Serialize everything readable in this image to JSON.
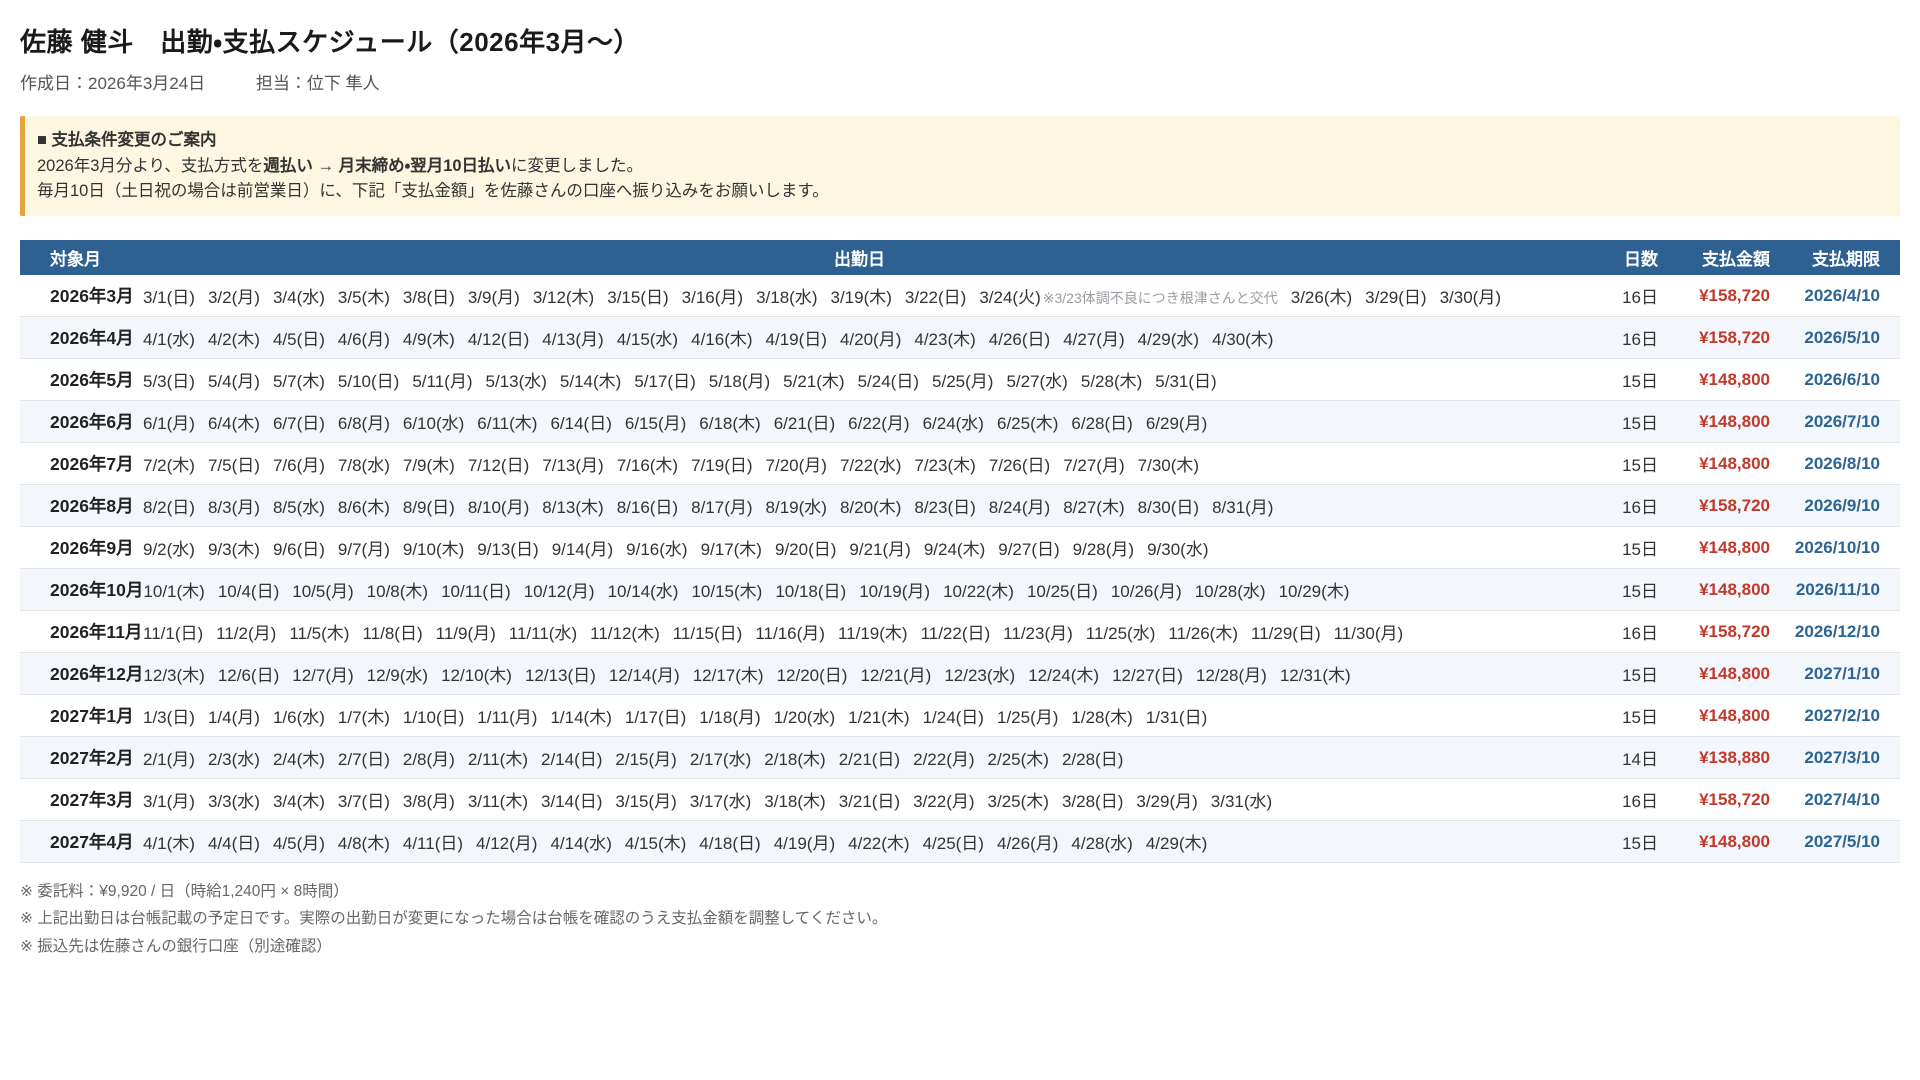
{
  "page": {
    "title": "佐藤 健斗　出勤・支払スケジュール（2026年3月〜）",
    "created_label": "作成日：2026年3月24日",
    "staff_label": "担当：位下 隼人"
  },
  "notice": {
    "heading": "■ 支払条件変更のご案内",
    "line1_pre": "2026年3月分より、支払方式を",
    "line1_bold1": "週払い",
    "line1_mid": " → ",
    "line1_bold2": "月末締め・翌月10日払い",
    "line1_post": "に変更しました。",
    "line2": "毎月10日（土日祝の場合は前営業日）に、下記「支払金額」を佐藤さんの口座へ振り込みをお願いします。"
  },
  "colors": {
    "table_header_bg": "#2e6191",
    "stripe_bg": "#f3f6fa",
    "amount_red": "#c0392b",
    "deadline_blue": "#2c6496",
    "notice_bg": "#fdf7e2",
    "notice_border": "#e8a33d"
  },
  "table": {
    "headers": {
      "month": "対象月",
      "dates": "出勤日",
      "days": "日数",
      "amount": "支払金額",
      "deadline": "支払期限"
    },
    "rows": [
      {
        "month": "2026年3月",
        "dates": [
          "3/1(日)",
          "3/2(月)",
          "3/4(水)",
          "3/5(木)",
          "3/8(日)",
          "3/9(月)",
          "3/12(木)",
          "3/15(日)",
          "3/16(月)",
          "3/18(水)",
          "3/19(木)",
          "3/22(日)",
          "3/24(火)",
          "3/26(木)",
          "3/29(日)",
          "3/30(月)"
        ],
        "inline_note": {
          "after_index": 12,
          "text": "※3/23体調不良につき根津さんと交代"
        },
        "days": "16日",
        "amount": "¥158,720",
        "deadline": "2026/4/10"
      },
      {
        "month": "2026年4月",
        "dates": [
          "4/1(水)",
          "4/2(木)",
          "4/5(日)",
          "4/6(月)",
          "4/9(木)",
          "4/12(日)",
          "4/13(月)",
          "4/15(水)",
          "4/16(木)",
          "4/19(日)",
          "4/20(月)",
          "4/23(木)",
          "4/26(日)",
          "4/27(月)",
          "4/29(水)",
          "4/30(木)"
        ],
        "days": "16日",
        "amount": "¥158,720",
        "deadline": "2026/5/10"
      },
      {
        "month": "2026年5月",
        "dates": [
          "5/3(日)",
          "5/4(月)",
          "5/7(木)",
          "5/10(日)",
          "5/11(月)",
          "5/13(水)",
          "5/14(木)",
          "5/17(日)",
          "5/18(月)",
          "5/21(木)",
          "5/24(日)",
          "5/25(月)",
          "5/27(水)",
          "5/28(木)",
          "5/31(日)"
        ],
        "days": "15日",
        "amount": "¥148,800",
        "deadline": "2026/6/10"
      },
      {
        "month": "2026年6月",
        "dates": [
          "6/1(月)",
          "6/4(木)",
          "6/7(日)",
          "6/8(月)",
          "6/10(水)",
          "6/11(木)",
          "6/14(日)",
          "6/15(月)",
          "6/18(木)",
          "6/21(日)",
          "6/22(月)",
          "6/24(水)",
          "6/25(木)",
          "6/28(日)",
          "6/29(月)"
        ],
        "days": "15日",
        "amount": "¥148,800",
        "deadline": "2026/7/10"
      },
      {
        "month": "2026年7月",
        "dates": [
          "7/2(木)",
          "7/5(日)",
          "7/6(月)",
          "7/8(水)",
          "7/9(木)",
          "7/12(日)",
          "7/13(月)",
          "7/16(木)",
          "7/19(日)",
          "7/20(月)",
          "7/22(水)",
          "7/23(木)",
          "7/26(日)",
          "7/27(月)",
          "7/30(木)"
        ],
        "days": "15日",
        "amount": "¥148,800",
        "deadline": "2026/8/10"
      },
      {
        "month": "2026年8月",
        "dates": [
          "8/2(日)",
          "8/3(月)",
          "8/5(水)",
          "8/6(木)",
          "8/9(日)",
          "8/10(月)",
          "8/13(木)",
          "8/16(日)",
          "8/17(月)",
          "8/19(水)",
          "8/20(木)",
          "8/23(日)",
          "8/24(月)",
          "8/27(木)",
          "8/30(日)",
          "8/31(月)"
        ],
        "days": "16日",
        "amount": "¥158,720",
        "deadline": "2026/9/10"
      },
      {
        "month": "2026年9月",
        "dates": [
          "9/2(水)",
          "9/3(木)",
          "9/6(日)",
          "9/7(月)",
          "9/10(木)",
          "9/13(日)",
          "9/14(月)",
          "9/16(水)",
          "9/17(木)",
          "9/20(日)",
          "9/21(月)",
          "9/24(木)",
          "9/27(日)",
          "9/28(月)",
          "9/30(水)"
        ],
        "days": "15日",
        "amount": "¥148,800",
        "deadline": "2026/10/10"
      },
      {
        "month": "2026年10月",
        "dates": [
          "10/1(木)",
          "10/4(日)",
          "10/5(月)",
          "10/8(木)",
          "10/11(日)",
          "10/12(月)",
          "10/14(水)",
          "10/15(木)",
          "10/18(日)",
          "10/19(月)",
          "10/22(木)",
          "10/25(日)",
          "10/26(月)",
          "10/28(水)",
          "10/29(木)"
        ],
        "days": "15日",
        "amount": "¥148,800",
        "deadline": "2026/11/10"
      },
      {
        "month": "2026年11月",
        "dates": [
          "11/1(日)",
          "11/2(月)",
          "11/5(木)",
          "11/8(日)",
          "11/9(月)",
          "11/11(水)",
          "11/12(木)",
          "11/15(日)",
          "11/16(月)",
          "11/19(木)",
          "11/22(日)",
          "11/23(月)",
          "11/25(水)",
          "11/26(木)",
          "11/29(日)",
          "11/30(月)"
        ],
        "days": "16日",
        "amount": "¥158,720",
        "deadline": "2026/12/10"
      },
      {
        "month": "2026年12月",
        "dates": [
          "12/3(木)",
          "12/6(日)",
          "12/7(月)",
          "12/9(水)",
          "12/10(木)",
          "12/13(日)",
          "12/14(月)",
          "12/17(木)",
          "12/20(日)",
          "12/21(月)",
          "12/23(水)",
          "12/24(木)",
          "12/27(日)",
          "12/28(月)",
          "12/31(木)"
        ],
        "days": "15日",
        "amount": "¥148,800",
        "deadline": "2027/1/10"
      },
      {
        "month": "2027年1月",
        "dates": [
          "1/3(日)",
          "1/4(月)",
          "1/6(水)",
          "1/7(木)",
          "1/10(日)",
          "1/11(月)",
          "1/14(木)",
          "1/17(日)",
          "1/18(月)",
          "1/20(水)",
          "1/21(木)",
          "1/24(日)",
          "1/25(月)",
          "1/28(木)",
          "1/31(日)"
        ],
        "days": "15日",
        "amount": "¥148,800",
        "deadline": "2027/2/10"
      },
      {
        "month": "2027年2月",
        "dates": [
          "2/1(月)",
          "2/3(水)",
          "2/4(木)",
          "2/7(日)",
          "2/8(月)",
          "2/11(木)",
          "2/14(日)",
          "2/15(月)",
          "2/17(水)",
          "2/18(木)",
          "2/21(日)",
          "2/22(月)",
          "2/25(木)",
          "2/28(日)"
        ],
        "days": "14日",
        "amount": "¥138,880",
        "deadline": "2027/3/10"
      },
      {
        "month": "2027年3月",
        "dates": [
          "3/1(月)",
          "3/3(水)",
          "3/4(木)",
          "3/7(日)",
          "3/8(月)",
          "3/11(木)",
          "3/14(日)",
          "3/15(月)",
          "3/17(水)",
          "3/18(木)",
          "3/21(日)",
          "3/22(月)",
          "3/25(木)",
          "3/28(日)",
          "3/29(月)",
          "3/31(水)"
        ],
        "days": "16日",
        "amount": "¥158,720",
        "deadline": "2027/4/10"
      },
      {
        "month": "2027年4月",
        "dates": [
          "4/1(木)",
          "4/4(日)",
          "4/5(月)",
          "4/8(木)",
          "4/11(日)",
          "4/12(月)",
          "4/14(水)",
          "4/15(木)",
          "4/18(日)",
          "4/19(月)",
          "4/22(木)",
          "4/25(日)",
          "4/26(月)",
          "4/28(水)",
          "4/29(木)"
        ],
        "days": "15日",
        "amount": "¥148,800",
        "deadline": "2027/5/10"
      }
    ]
  },
  "footnotes": [
    "※ 委託料：¥9,920 / 日（時給1,240円 × 8時間）",
    "※ 上記出勤日は台帳記載の予定日です。実際の出勤日が変更になった場合は台帳を確認のうえ支払金額を調整してください。",
    "※ 振込先は佐藤さんの銀行口座（別途確認）"
  ]
}
